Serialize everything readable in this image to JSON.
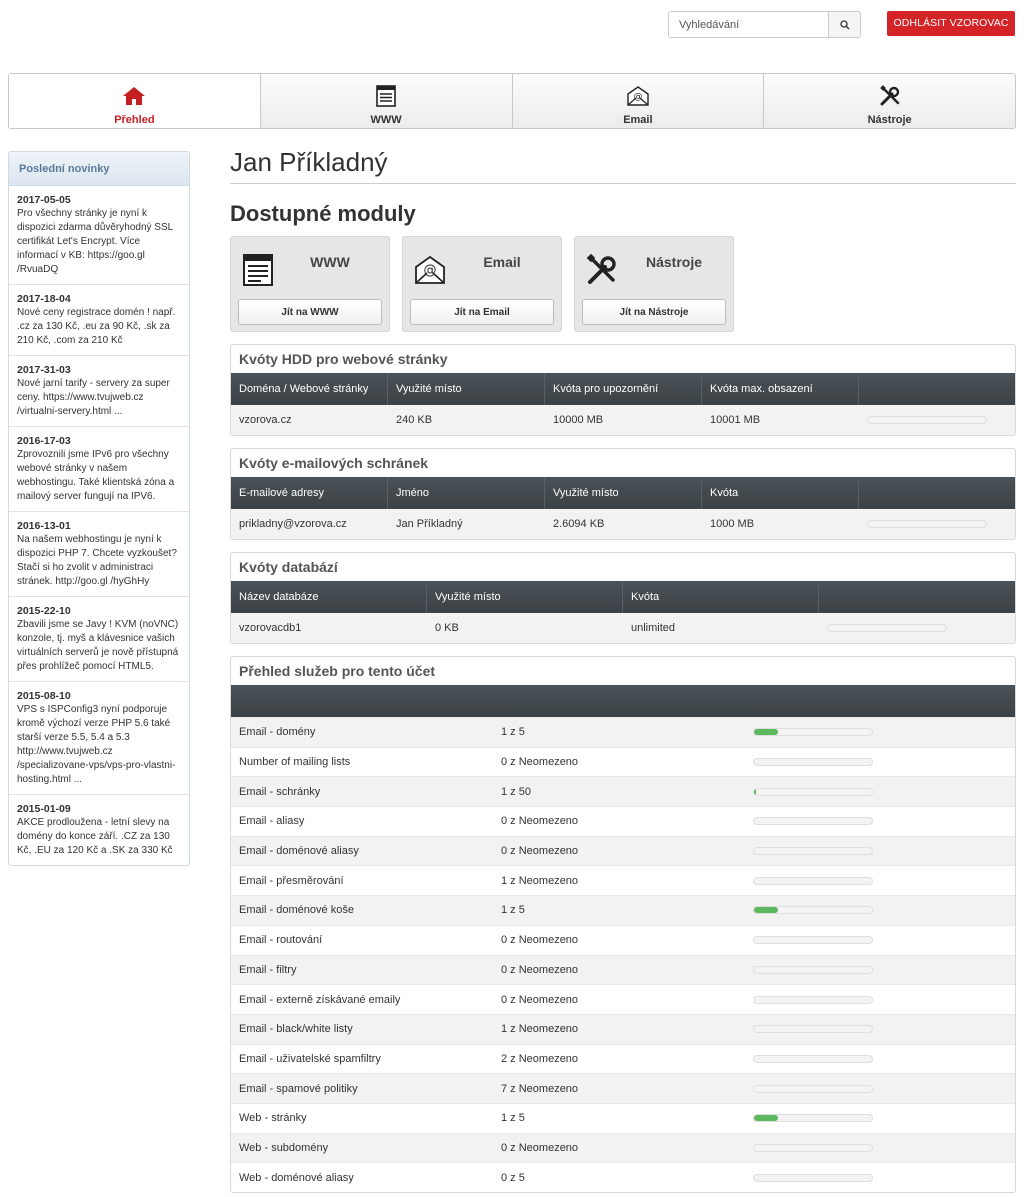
{
  "search": {
    "placeholder": "Vyhledávání"
  },
  "logout": {
    "label": "ODHLÁSIT VZOROVAC"
  },
  "nav": [
    {
      "label": "Přehled",
      "icon": "home-icon",
      "active": true
    },
    {
      "label": "WWW",
      "icon": "webpage-icon",
      "active": false
    },
    {
      "label": "Email",
      "icon": "email-icon",
      "active": false
    },
    {
      "label": "Nástroje",
      "icon": "tools-icon",
      "active": false
    }
  ],
  "sidebar": {
    "title": "Poslední novinky",
    "news": [
      {
        "date": "2017-05-05",
        "text": "Pro všechny stránky je nyní k dispozici zdarma důvěryhodný SSL certifikát Let's Encrypt. Více informací v KB: https://goo.gl /RvuaDQ"
      },
      {
        "date": "2017-18-04",
        "text": "Nové ceny registrace domén ! např. .cz za 130 Kč, .eu za 90 Kč, .sk za 210 Kč, .com za 210 Kč"
      },
      {
        "date": "2017-31-03",
        "text": "Nové jarní tarify - servery za super ceny. https://www.tvujweb.cz /virtualni-servery.html ..."
      },
      {
        "date": "2016-17-03",
        "text": "Zprovoznili jsme IPv6 pro všechny webové stránky v našem webhostingu. Také klientská zóna a mailový server fungují na IPV6."
      },
      {
        "date": "2016-13-01",
        "text": "Na našem webhostingu je nyní k dispozici PHP 7. Chcete vyzkoušet? Stačí si ho zvolit v administraci stránek. http://goo.gl /hyGhHy"
      },
      {
        "date": "2015-22-10",
        "text": "Zbavili jsme se Javy ! KVM (noVNC) konzole, tj. myš a klávesnice vašich virtuálních serverů je nově přístupná přes prohlížeč pomocí HTML5."
      },
      {
        "date": "2015-08-10",
        "text": "VPS s ISPConfig3 nyní podporuje kromě výchozí verze PHP 5.6 také starší verze 5.5, 5.4 a 5.3 http://www.tvujweb.cz /specializovane-vps/vps-pro-vlastni-hosting.html ..."
      },
      {
        "date": "2015-01-09",
        "text": "AKCE prodloužena - letní slevy na domény do konce září. .CZ za 130 Kč, .EU za 120 Kč a .SK za 330 Kč"
      }
    ]
  },
  "page_title": "Jan Příkladný",
  "modules_title": "Dostupné moduly",
  "modules": [
    {
      "title": "WWW",
      "button": "Jít na WWW",
      "icon": "webpage-icon"
    },
    {
      "title": "Email",
      "button": "Jít na Email",
      "icon": "email-icon"
    },
    {
      "title": "Nástroje",
      "button": "Jít na Nástroje",
      "icon": "tools-icon"
    }
  ],
  "hdd": {
    "title": "Kvóty HDD pro webové stránky",
    "headers": [
      "Doména / Webové stránky",
      "Využité místo",
      "Kvóta pro upozornění",
      "Kvóta max. obsazení"
    ],
    "rows": [
      {
        "c1": "vzorova.cz",
        "c2": "240 KB",
        "c3": "10000 MB",
        "c4": "10001 MB",
        "fill": 0.0
      }
    ]
  },
  "mail": {
    "title": "Kvóty e-mailových schránek",
    "headers": [
      "E-mailové adresy",
      "Jméno",
      "Využité místo",
      "Kvóta"
    ],
    "rows": [
      {
        "c1": "prikladny@vzorova.cz",
        "c2": "Jan Příkladný",
        "c3": "2.6094 KB",
        "c4": "1000 MB",
        "fill": 0.0
      }
    ]
  },
  "db": {
    "title": "Kvóty databází",
    "headers": [
      "Název databáze",
      "Využité místo",
      "Kvóta"
    ],
    "rows": [
      {
        "c1": "vzorovacdb1",
        "c2": "0 KB",
        "c3": "unlimited",
        "fill": 0.0
      }
    ]
  },
  "services": {
    "title": "Přehled služeb pro tento účet",
    "rows": [
      {
        "name": "Email - domény",
        "value": "1 z 5",
        "fill": 0.2
      },
      {
        "name": "Number of mailing lists",
        "value": "0 z Neomezeno",
        "fill": 0
      },
      {
        "name": "Email - schránky",
        "value": "1 z 50",
        "fill": 0.02
      },
      {
        "name": "Email - aliasy",
        "value": "0 z Neomezeno",
        "fill": 0
      },
      {
        "name": "Email - doménové aliasy",
        "value": "0 z Neomezeno",
        "fill": 0
      },
      {
        "name": "Email - přesměrování",
        "value": "1 z Neomezeno",
        "fill": 0
      },
      {
        "name": "Email - doménové koše",
        "value": "1 z 5",
        "fill": 0.2
      },
      {
        "name": "Email - routování",
        "value": "0 z Neomezeno",
        "fill": 0
      },
      {
        "name": "Email - filtry",
        "value": "0 z Neomezeno",
        "fill": 0
      },
      {
        "name": "Email - externě získávané emaily",
        "value": "0 z Neomezeno",
        "fill": 0
      },
      {
        "name": "Email - black/white listy",
        "value": "1 z Neomezeno",
        "fill": 0
      },
      {
        "name": "Email - uživatelské spamfiltry",
        "value": "2 z Neomezeno",
        "fill": 0
      },
      {
        "name": "Email - spamové politiky",
        "value": "7 z Neomezeno",
        "fill": 0
      },
      {
        "name": "Web - stránky",
        "value": "1 z 5",
        "fill": 0.2
      },
      {
        "name": "Web - subdomény",
        "value": "0 z Neomezeno",
        "fill": 0
      },
      {
        "name": "Web - doménové aliasy",
        "value": "0 z 5",
        "fill": 0
      }
    ]
  },
  "colors": {
    "accent": "#d42427",
    "header_dark": "#3f4549",
    "progress": "#5cb85c"
  }
}
